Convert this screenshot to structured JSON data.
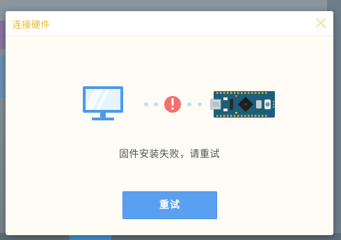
{
  "dialog": {
    "title": "连接硬件",
    "close_icon": "close-icon",
    "message": "固件安装失败，请重试",
    "retry_label": "重试"
  },
  "illustration": {
    "computer_icon": "monitor-icon",
    "status_icon": "error-exclamation-icon",
    "board_icon": "arduino-nano-icon"
  },
  "colors": {
    "title": "#f2b718",
    "button": "#5aa0f0",
    "error": "#f27070",
    "monitor": "#4a9af0",
    "board": "#1c5f7a"
  }
}
